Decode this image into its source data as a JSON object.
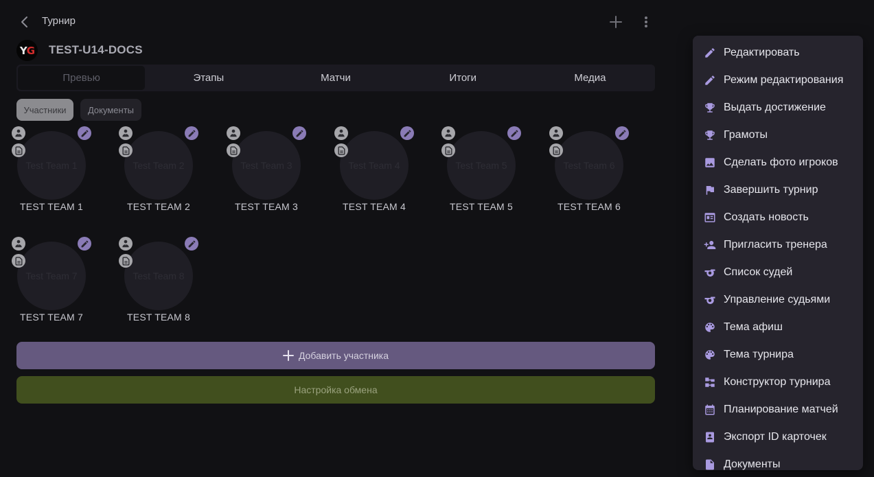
{
  "header": {
    "breadcrumb": "Турнир",
    "title": "TEST-U14-DOCS",
    "logo_letters": [
      "Y",
      "G"
    ]
  },
  "tabs": [
    {
      "label": "Превью",
      "active": true
    },
    {
      "label": "Этапы",
      "active": false
    },
    {
      "label": "Матчи",
      "active": false
    },
    {
      "label": "Итоги",
      "active": false
    },
    {
      "label": "Медиа",
      "active": false
    }
  ],
  "subtabs": {
    "participants": "Участники",
    "documents": "Документы"
  },
  "teams": [
    {
      "placeholder": "Test Team 1",
      "name": "TEST TEAM 1"
    },
    {
      "placeholder": "Test Team 2",
      "name": "TEST TEAM 2"
    },
    {
      "placeholder": "Test Team 3",
      "name": "TEST TEAM 3"
    },
    {
      "placeholder": "Test Team 4",
      "name": "TEST TEAM 4"
    },
    {
      "placeholder": "Test Team 5",
      "name": "TEST TEAM 5"
    },
    {
      "placeholder": "Test Team 6",
      "name": "TEST TEAM 6"
    },
    {
      "placeholder": "Test Team 7",
      "name": "TEST TEAM 7"
    },
    {
      "placeholder": "Test Team 8",
      "name": "TEST TEAM 8"
    }
  ],
  "actions": {
    "add_participant": "Добавить участника",
    "exchange_settings": "Настройка обмена"
  },
  "menu": {
    "items": [
      {
        "label": "Редактировать",
        "icon": "pencil-icon"
      },
      {
        "label": "Режим редактирования",
        "icon": "pencil-icon"
      },
      {
        "label": "Выдать достижение",
        "icon": "trophy-icon"
      },
      {
        "label": "Грамоты",
        "icon": "trophy-icon"
      },
      {
        "label": "Сделать фото игроков",
        "icon": "image-icon"
      },
      {
        "label": "Завершить турнир",
        "icon": "flag-icon"
      },
      {
        "label": "Создать новость",
        "icon": "newspaper-icon"
      },
      {
        "label": "Пригласить тренера",
        "icon": "person-add-icon"
      },
      {
        "label": "Список судей",
        "icon": "whistle-icon"
      },
      {
        "label": "Управление судьями",
        "icon": "whistle-icon"
      },
      {
        "label": "Тема афиш",
        "icon": "palette-icon"
      },
      {
        "label": "Тема турнира",
        "icon": "palette-icon"
      },
      {
        "label": "Конструктор турнира",
        "icon": "bracket-icon"
      },
      {
        "label": "Планирование матчей",
        "icon": "calendar-icon"
      },
      {
        "label": "Экспорт ID карточек",
        "icon": "id-card-icon"
      },
      {
        "label": "Документы",
        "icon": "document-icon"
      }
    ]
  },
  "colors": {
    "background": "#111114",
    "accent_purple": "#65597f",
    "accent_green": "#414f1e",
    "menu_bg": "#26242d",
    "icon_purple": "#a99ae0"
  }
}
